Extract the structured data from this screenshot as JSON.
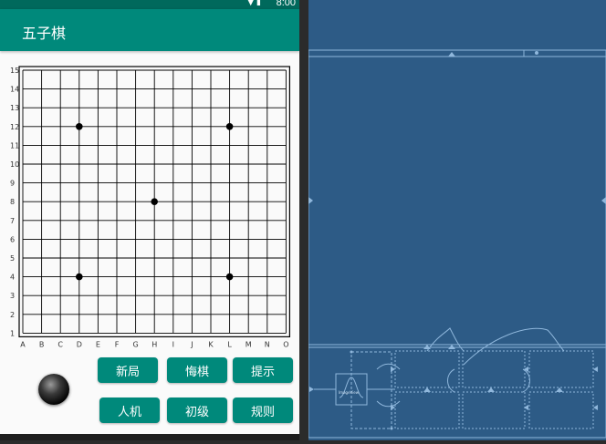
{
  "status_bar": {
    "time": "8:00",
    "icons": "▼ ▮"
  },
  "app_bar": {
    "title": "五子棋"
  },
  "board": {
    "size": 15,
    "col_labels": [
      "A",
      "B",
      "C",
      "D",
      "E",
      "F",
      "G",
      "H",
      "I",
      "J",
      "K",
      "L",
      "M",
      "N",
      "O"
    ],
    "row_labels": [
      "1",
      "2",
      "3",
      "4",
      "5",
      "6",
      "7",
      "8",
      "9",
      "10",
      "11",
      "12",
      "13",
      "14",
      "15"
    ],
    "star_points": [
      {
        "col": "D",
        "row": 12
      },
      {
        "col": "L",
        "row": 12
      },
      {
        "col": "H",
        "row": 8
      },
      {
        "col": "D",
        "row": 4
      },
      {
        "col": "L",
        "row": 4
      }
    ]
  },
  "buttons": {
    "new_game": "新局",
    "undo": "悔棋",
    "hint": "提示",
    "vs_ai": "人机",
    "level": "初级",
    "rules": "规则"
  },
  "current_stone": {
    "color": "black"
  },
  "blueprint": {
    "image_view_label": "ImageView",
    "colors": {
      "background": "#2d5b86",
      "lines": "#8fb7dc"
    }
  },
  "colors": {
    "accent": "#00897b",
    "status": "#00695c"
  }
}
